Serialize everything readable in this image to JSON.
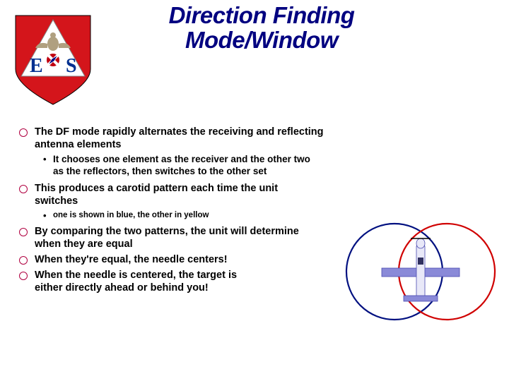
{
  "title": "Direction Finding Mode/Window",
  "logo": {
    "left_letter": "E",
    "right_letter": "S"
  },
  "bullets": {
    "b1": "The DF mode rapidly alternates the receiving and reflecting antenna elements",
    "b1s1": "It chooses one element as the receiver and the other two as the reflectors, then switches to the other set",
    "b2": "This produces a carotid pattern each time the unit switches",
    "b2s1": "one is shown in blue, the other in yellow",
    "b3": "By comparing the two patterns, the unit will determine when they are equal",
    "b4": "When they're equal, the needle centers!",
    "b5": "When the needle is centered, the target is either directly ahead or behind you!"
  }
}
